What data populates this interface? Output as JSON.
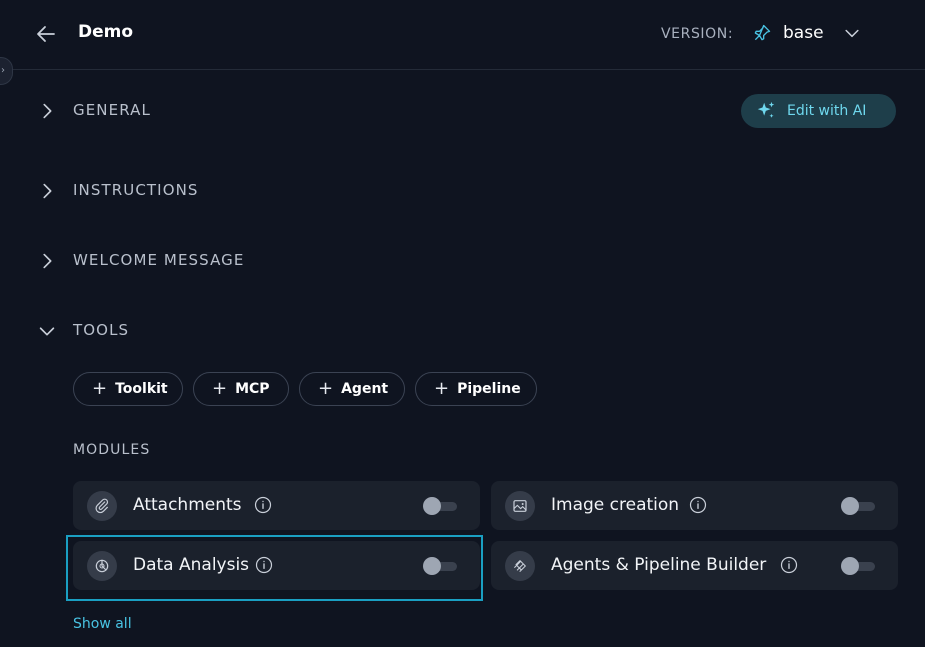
{
  "header": {
    "title": "Demo",
    "version_label": "VERSION:",
    "version_value": "base"
  },
  "sections": {
    "general": "GENERAL",
    "instructions": "INSTRUCTIONS",
    "welcome": "WELCOME MESSAGE",
    "tools": "TOOLS"
  },
  "edit_ai": {
    "label": "Edit with AI"
  },
  "tools": {
    "chips": [
      "Toolkit",
      "MCP",
      "Agent",
      "Pipeline"
    ]
  },
  "modules": {
    "label": "MODULES",
    "items": [
      {
        "name": "Attachments",
        "enabled": false,
        "icon": "paperclip-icon"
      },
      {
        "name": "Image creation",
        "enabled": false,
        "icon": "image-icon"
      },
      {
        "name": "Data Analysis",
        "enabled": false,
        "icon": "data-analysis-icon"
      },
      {
        "name": "Agents & Pipeline Builder",
        "enabled": false,
        "icon": "builder-icon"
      }
    ],
    "show_all": "Show all"
  },
  "colors": {
    "background": "#0f1420",
    "card": "#1b212c",
    "accent": "#49c3e3",
    "highlight": "#1a9fc2"
  }
}
